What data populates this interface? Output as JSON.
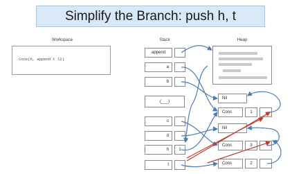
{
  "title": "Simplify the Branch: push h, t",
  "labels": {
    "workspace": "Workspace",
    "stack": "Stack",
    "heap": "Heap"
  },
  "workspace": {
    "code": "Cons(h, append t l2)"
  },
  "stack": {
    "append": "append",
    "a": "a",
    "b": "b",
    "frame": "(___)",
    "c": "c",
    "d": "d",
    "h": "h",
    "h_value": "1",
    "t": "t"
  },
  "heap": {
    "nil1": "Nil",
    "cons1": "Cons",
    "cons1_value": "1",
    "nil2": "Nil",
    "cons2": "Cons",
    "cons2_value": "3",
    "cons3": "Cons",
    "cons3_value": "2"
  },
  "colors": {
    "banner": "#d9e8f6",
    "arrow_blue": "#4a7ab8",
    "arrow_red": "#c0392b"
  }
}
